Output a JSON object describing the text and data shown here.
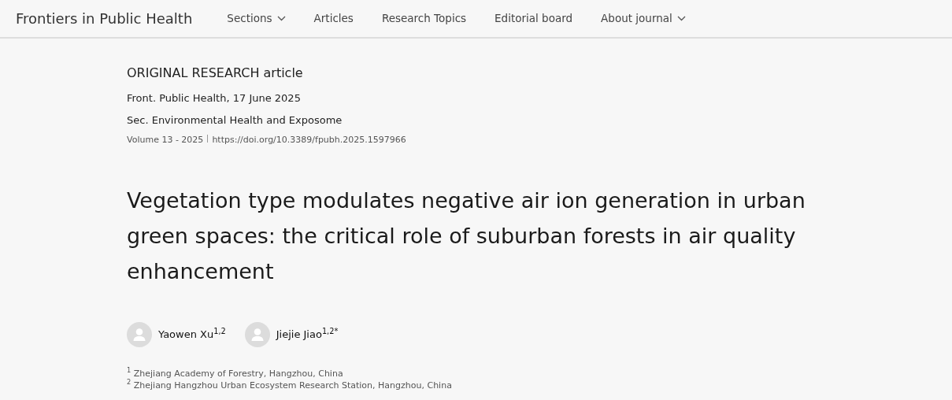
{
  "navbar": {
    "brand": "Frontiers in Public Health",
    "items": [
      {
        "label": "Sections",
        "dropdown": true
      },
      {
        "label": "Articles",
        "dropdown": false
      },
      {
        "label": "Research Topics",
        "dropdown": false
      },
      {
        "label": "Editorial board",
        "dropdown": false
      },
      {
        "label": "About journal",
        "dropdown": true
      }
    ]
  },
  "article": {
    "type": "ORIGINAL RESEARCH article",
    "citation": "Front. Public Health, 17 June 2025",
    "section": "Sec. Environmental Health and Exposome",
    "volume": "Volume 13 - 2025",
    "doi": "https://doi.org/10.3389/fpubh.2025.1597966",
    "title": "Vegetation type modulates negative air ion generation in urban green spaces: the critical role of suburban forests in air quality enhancement",
    "authors": [
      {
        "name": "Yaowen Xu$^{1,2}$"
      },
      {
        "name": "Jiejie Jiao$^{1,2*}$"
      }
    ],
    "affiliations": [
      "$^{1}$ Zhejiang Academy of Forestry, Hangzhou, China",
      "$^{2}$ Zhejiang Hangzhou Urban Ecosystem Research Station, Hangzhou, China"
    ]
  }
}
